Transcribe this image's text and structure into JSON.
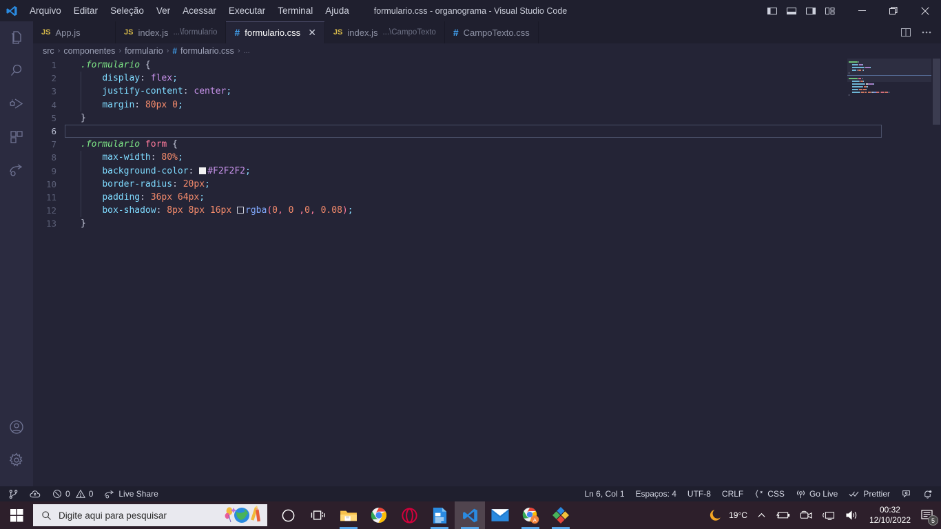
{
  "window": {
    "title": "formulario.css - organograma - Visual Studio Code",
    "minimize_label": "—",
    "restore_label": "❐",
    "close_label": "✕"
  },
  "menu": {
    "items": [
      {
        "label": "Arquivo",
        "name": "menu-arquivo"
      },
      {
        "label": "Editar",
        "name": "menu-editar"
      },
      {
        "label": "Seleção",
        "name": "menu-selecao"
      },
      {
        "label": "Ver",
        "name": "menu-ver"
      },
      {
        "label": "Acessar",
        "name": "menu-acessar"
      },
      {
        "label": "Executar",
        "name": "menu-executar"
      },
      {
        "label": "Terminal",
        "name": "menu-terminal"
      },
      {
        "label": "Ajuda",
        "name": "menu-ajuda"
      }
    ]
  },
  "layout_controls": [
    {
      "icon": "toggle-primary-sidebar-icon"
    },
    {
      "icon": "toggle-panel-icon"
    },
    {
      "icon": "toggle-secondary-sidebar-icon"
    },
    {
      "icon": "customize-layout-icon"
    }
  ],
  "activitybar": {
    "items": [
      {
        "icon": "explorer-icon",
        "label": "Explorer"
      },
      {
        "icon": "search-icon",
        "label": "Search"
      },
      {
        "icon": "run-and-debug-icon",
        "label": "Run and Debug"
      },
      {
        "icon": "extensions-icon",
        "label": "Extensions"
      },
      {
        "icon": "live-share-icon",
        "label": "Live Share"
      }
    ],
    "bottom": [
      {
        "icon": "account-icon",
        "label": "Accounts"
      },
      {
        "icon": "gear-icon",
        "label": "Manage"
      }
    ]
  },
  "tabs": [
    {
      "label": "App.js",
      "sub": "",
      "icon": "js",
      "active": false,
      "closable": false
    },
    {
      "label": "index.js",
      "sub": "...\\formulario",
      "icon": "js",
      "active": false,
      "closable": false
    },
    {
      "label": "formulario.css",
      "sub": "",
      "icon": "css",
      "active": true,
      "closable": true
    },
    {
      "label": "index.js",
      "sub": "...\\CampoTexto",
      "icon": "js",
      "active": false,
      "closable": false
    },
    {
      "label": "CampoTexto.css",
      "sub": "",
      "icon": "css",
      "active": false,
      "closable": false
    }
  ],
  "tabs_actions": [
    {
      "icon": "split-editor-icon"
    },
    {
      "icon": "more-actions-icon",
      "label": "..."
    }
  ],
  "breadcrumb": {
    "parts": [
      "src",
      "componentes",
      "formulario",
      "formulario.css",
      "..."
    ],
    "separator": "›",
    "file_icon": "css-hash-icon"
  },
  "editor": {
    "language": "CSS",
    "current_line": 6,
    "lines": [
      {
        "n": 1,
        "tokens": [
          {
            "t": ".formulario",
            "c": "sel"
          },
          {
            "t": " ",
            "c": "plain"
          },
          {
            "t": "{",
            "c": "brace"
          }
        ]
      },
      {
        "n": 2,
        "tokens": [
          {
            "t": "    ",
            "c": "plain"
          },
          {
            "t": "display",
            "c": "prop"
          },
          {
            "t": ":",
            "c": "colon"
          },
          {
            "t": " ",
            "c": "plain"
          },
          {
            "t": "flex",
            "c": "val"
          },
          {
            "t": ";",
            "c": "semi"
          }
        ]
      },
      {
        "n": 3,
        "tokens": [
          {
            "t": "    ",
            "c": "plain"
          },
          {
            "t": "justify-content",
            "c": "prop"
          },
          {
            "t": ":",
            "c": "colon"
          },
          {
            "t": " ",
            "c": "plain"
          },
          {
            "t": "center",
            "c": "val"
          },
          {
            "t": ";",
            "c": "semi"
          }
        ]
      },
      {
        "n": 4,
        "tokens": [
          {
            "t": "    ",
            "c": "plain"
          },
          {
            "t": "margin",
            "c": "prop"
          },
          {
            "t": ":",
            "c": "colon"
          },
          {
            "t": " ",
            "c": "plain"
          },
          {
            "t": "80",
            "c": "num"
          },
          {
            "t": "px",
            "c": "unit"
          },
          {
            "t": " ",
            "c": "plain"
          },
          {
            "t": "0",
            "c": "num"
          },
          {
            "t": ";",
            "c": "semi"
          }
        ]
      },
      {
        "n": 5,
        "tokens": [
          {
            "t": "}",
            "c": "brace"
          }
        ]
      },
      {
        "n": 6,
        "tokens": []
      },
      {
        "n": 7,
        "tokens": [
          {
            "t": ".formulario",
            "c": "sel"
          },
          {
            "t": " ",
            "c": "plain"
          },
          {
            "t": "form",
            "c": "tagsel"
          },
          {
            "t": " ",
            "c": "plain"
          },
          {
            "t": "{",
            "c": "brace"
          }
        ]
      },
      {
        "n": 8,
        "tokens": [
          {
            "t": "    ",
            "c": "plain"
          },
          {
            "t": "max-width",
            "c": "prop"
          },
          {
            "t": ":",
            "c": "colon"
          },
          {
            "t": " ",
            "c": "plain"
          },
          {
            "t": "80",
            "c": "num"
          },
          {
            "t": "%",
            "c": "unit"
          },
          {
            "t": ";",
            "c": "semi"
          }
        ]
      },
      {
        "n": 9,
        "tokens": [
          {
            "t": "    ",
            "c": "plain"
          },
          {
            "t": "background-color",
            "c": "prop"
          },
          {
            "t": ":",
            "c": "colon"
          },
          {
            "t": " ",
            "c": "plain"
          },
          {
            "t": "",
            "c": "swatch-fill"
          },
          {
            "t": "#F2F2F2",
            "c": "val"
          },
          {
            "t": ";",
            "c": "semi"
          }
        ]
      },
      {
        "n": 10,
        "tokens": [
          {
            "t": "    ",
            "c": "plain"
          },
          {
            "t": "border-radius",
            "c": "prop"
          },
          {
            "t": ":",
            "c": "colon"
          },
          {
            "t": " ",
            "c": "plain"
          },
          {
            "t": "20",
            "c": "num"
          },
          {
            "t": "px",
            "c": "unit"
          },
          {
            "t": ";",
            "c": "semi"
          }
        ]
      },
      {
        "n": 11,
        "tokens": [
          {
            "t": "    ",
            "c": "plain"
          },
          {
            "t": "padding",
            "c": "prop"
          },
          {
            "t": ":",
            "c": "colon"
          },
          {
            "t": " ",
            "c": "plain"
          },
          {
            "t": "36",
            "c": "num"
          },
          {
            "t": "px",
            "c": "unit"
          },
          {
            "t": " ",
            "c": "plain"
          },
          {
            "t": "64",
            "c": "num"
          },
          {
            "t": "px",
            "c": "unit"
          },
          {
            "t": ";",
            "c": "semi"
          }
        ]
      },
      {
        "n": 12,
        "tokens": [
          {
            "t": "    ",
            "c": "plain"
          },
          {
            "t": "box-shadow",
            "c": "prop"
          },
          {
            "t": ":",
            "c": "colon"
          },
          {
            "t": " ",
            "c": "plain"
          },
          {
            "t": "8",
            "c": "num"
          },
          {
            "t": "px",
            "c": "unit"
          },
          {
            "t": " ",
            "c": "plain"
          },
          {
            "t": "8",
            "c": "num"
          },
          {
            "t": "px",
            "c": "unit"
          },
          {
            "t": " ",
            "c": "plain"
          },
          {
            "t": "16",
            "c": "num"
          },
          {
            "t": "px",
            "c": "unit"
          },
          {
            "t": " ",
            "c": "plain"
          },
          {
            "t": "",
            "c": "swatch-empty"
          },
          {
            "t": "rgba",
            "c": "fn"
          },
          {
            "t": "(",
            "c": "punc"
          },
          {
            "t": "0",
            "c": "num"
          },
          {
            "t": ",",
            "c": "punc"
          },
          {
            "t": " ",
            "c": "plain"
          },
          {
            "t": "0",
            "c": "num"
          },
          {
            "t": " ",
            "c": "plain"
          },
          {
            "t": ",",
            "c": "punc"
          },
          {
            "t": "0",
            "c": "num"
          },
          {
            "t": ",",
            "c": "punc"
          },
          {
            "t": " ",
            "c": "plain"
          },
          {
            "t": "0.08",
            "c": "num"
          },
          {
            "t": ")",
            "c": "punc"
          },
          {
            "t": ";",
            "c": "semi"
          }
        ]
      },
      {
        "n": 13,
        "tokens": [
          {
            "t": "}",
            "c": "brace"
          }
        ]
      }
    ]
  },
  "statusbar": {
    "left": [
      {
        "name": "source-control-branch-icon",
        "label": "",
        "icon": "branch"
      },
      {
        "name": "remote-indicator-icon",
        "label": "",
        "icon": "cloud"
      },
      {
        "name": "problems-indicator",
        "label": "0  0",
        "errors": "0",
        "warnings": "0",
        "icon": "error-warning"
      },
      {
        "name": "live-share-button",
        "label": "Live Share",
        "icon": "live-share"
      }
    ],
    "right": [
      {
        "name": "editor-position",
        "label": "Ln 6, Col 1"
      },
      {
        "name": "editor-indentation",
        "label": "Espaços: 4"
      },
      {
        "name": "editor-encoding",
        "label": "UTF-8"
      },
      {
        "name": "editor-eol",
        "label": "CRLF"
      },
      {
        "name": "editor-language",
        "label": "CSS",
        "icon": "css-braces"
      },
      {
        "name": "go-live-button",
        "label": "Go Live",
        "icon": "broadcast"
      },
      {
        "name": "prettier-status",
        "label": "Prettier",
        "icon": "checks"
      },
      {
        "name": "feedback-icon",
        "label": "",
        "icon": "tweet"
      },
      {
        "name": "notifications-bell",
        "label": "",
        "icon": "bell-dot"
      }
    ]
  },
  "taskbar": {
    "search_placeholder": "Digite aqui para pesquisar",
    "apps": [
      {
        "name": "taskbar-cortana",
        "icon": "cortana-circle",
        "active": false,
        "running": false
      },
      {
        "name": "taskbar-task-view",
        "icon": "task-view",
        "active": false,
        "running": false
      },
      {
        "name": "taskbar-file-explorer",
        "icon": "file-explorer",
        "active": false,
        "running": true
      },
      {
        "name": "taskbar-chrome",
        "icon": "chrome",
        "active": false,
        "running": false
      },
      {
        "name": "taskbar-opera",
        "icon": "opera",
        "active": false,
        "running": false
      },
      {
        "name": "taskbar-libreoffice-writer",
        "icon": "writer-doc",
        "active": false,
        "running": true
      },
      {
        "name": "taskbar-vscode",
        "icon": "vscode",
        "active": true,
        "running": true
      },
      {
        "name": "taskbar-mail",
        "icon": "mail",
        "active": false,
        "running": false
      },
      {
        "name": "taskbar-chrome-profile",
        "icon": "chrome-badge-a",
        "active": false,
        "running": true
      },
      {
        "name": "taskbar-paint3d",
        "icon": "diamond-colors",
        "active": false,
        "running": true
      }
    ],
    "tray": {
      "weather": "19°C",
      "weather_icon": "moon-icon",
      "chevron": "∧",
      "icons": [
        "battery-icon",
        "camera-icon",
        "network-display-icon",
        "volume-icon"
      ],
      "time": "00:32",
      "date": "12/10/2022",
      "notification_count": "5"
    }
  },
  "colors": {
    "titlebar_bg": "#1f1f2e",
    "activitybar_bg": "#2b2b40",
    "editor_bg": "#242436",
    "accent_blue": "#42a5f5",
    "taskbar_bg": "#2d1f2b",
    "selector_green": "#7ee787",
    "value_purple": "#c792ea",
    "number_orange": "#f78c6c"
  }
}
